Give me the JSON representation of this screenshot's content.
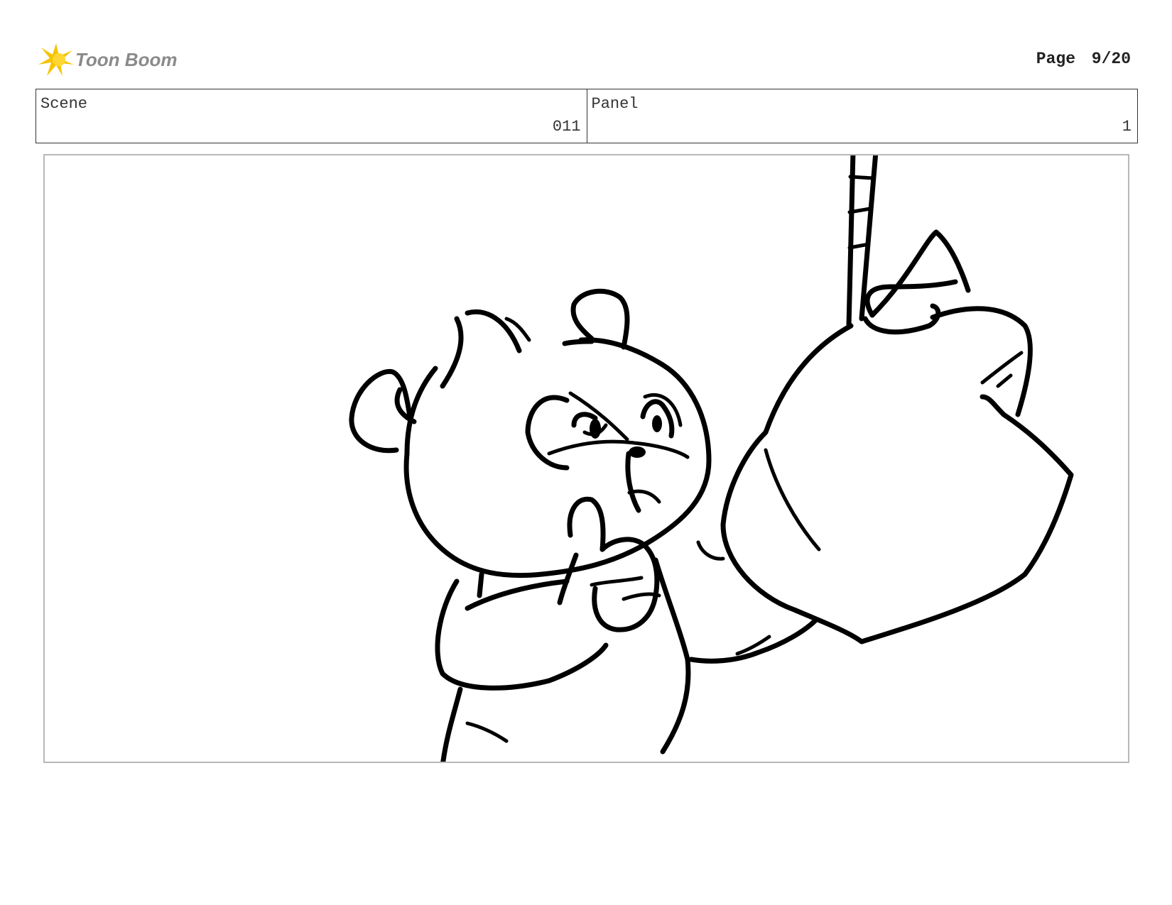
{
  "header": {
    "logo_text": "Toon Boom",
    "logo_icon": "sparkle-burst-icon",
    "brand_color": "#f5c400",
    "page_label": "Page",
    "page_number": "9/20"
  },
  "info": {
    "scene_label": "Scene",
    "scene_value": "011",
    "panel_label": "Panel",
    "panel_value": "1"
  },
  "panel": {
    "image_subject": "bear-and-hanging-punching-bag-sketch"
  }
}
